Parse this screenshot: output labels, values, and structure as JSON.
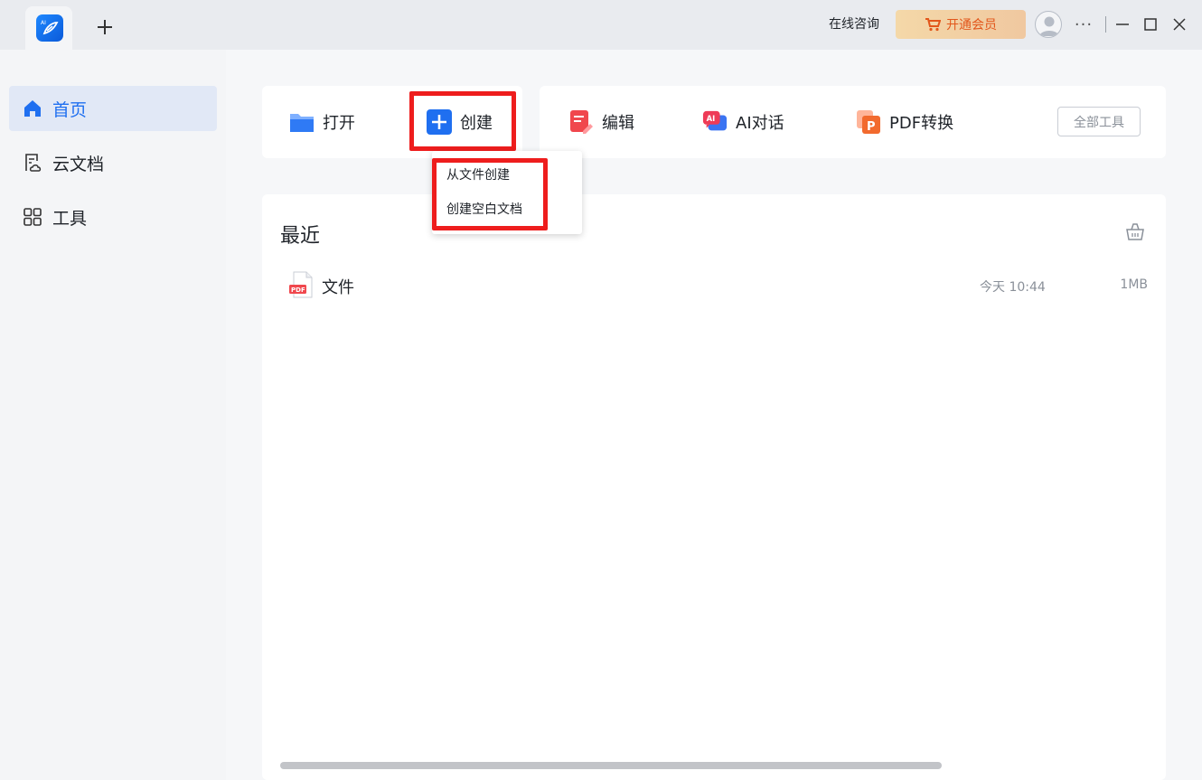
{
  "titlebar": {
    "new_tab_icon": "plus-icon",
    "consult_label": "在线咨询",
    "vip_label": "开通会员",
    "vip_icon": "cart-icon",
    "more_label": "···"
  },
  "sidebar": {
    "items": [
      {
        "label": "首页",
        "icon": "home-icon",
        "active": true
      },
      {
        "label": "云文档",
        "icon": "cloud-doc-icon",
        "active": false
      },
      {
        "label": "工具",
        "icon": "grid-icon",
        "active": false
      }
    ]
  },
  "toolbar": {
    "open_label": "打开",
    "create_label": "创建",
    "edit_label": "编辑",
    "ai_chat_label": "AI对话",
    "pdf_convert_label": "PDF转换",
    "all_tools_label": "全部工具"
  },
  "create_menu": {
    "items": [
      "从文件创建",
      "创建空白文档"
    ]
  },
  "recent": {
    "title": "最近",
    "files": [
      {
        "name": "文件",
        "time": "今天 10:44",
        "size": "1MB",
        "type_badge": "PDF"
      }
    ]
  },
  "colors": {
    "accent": "#1f6ff0",
    "highlight": "#ee1d1d",
    "vip_text": "#e2561b"
  }
}
